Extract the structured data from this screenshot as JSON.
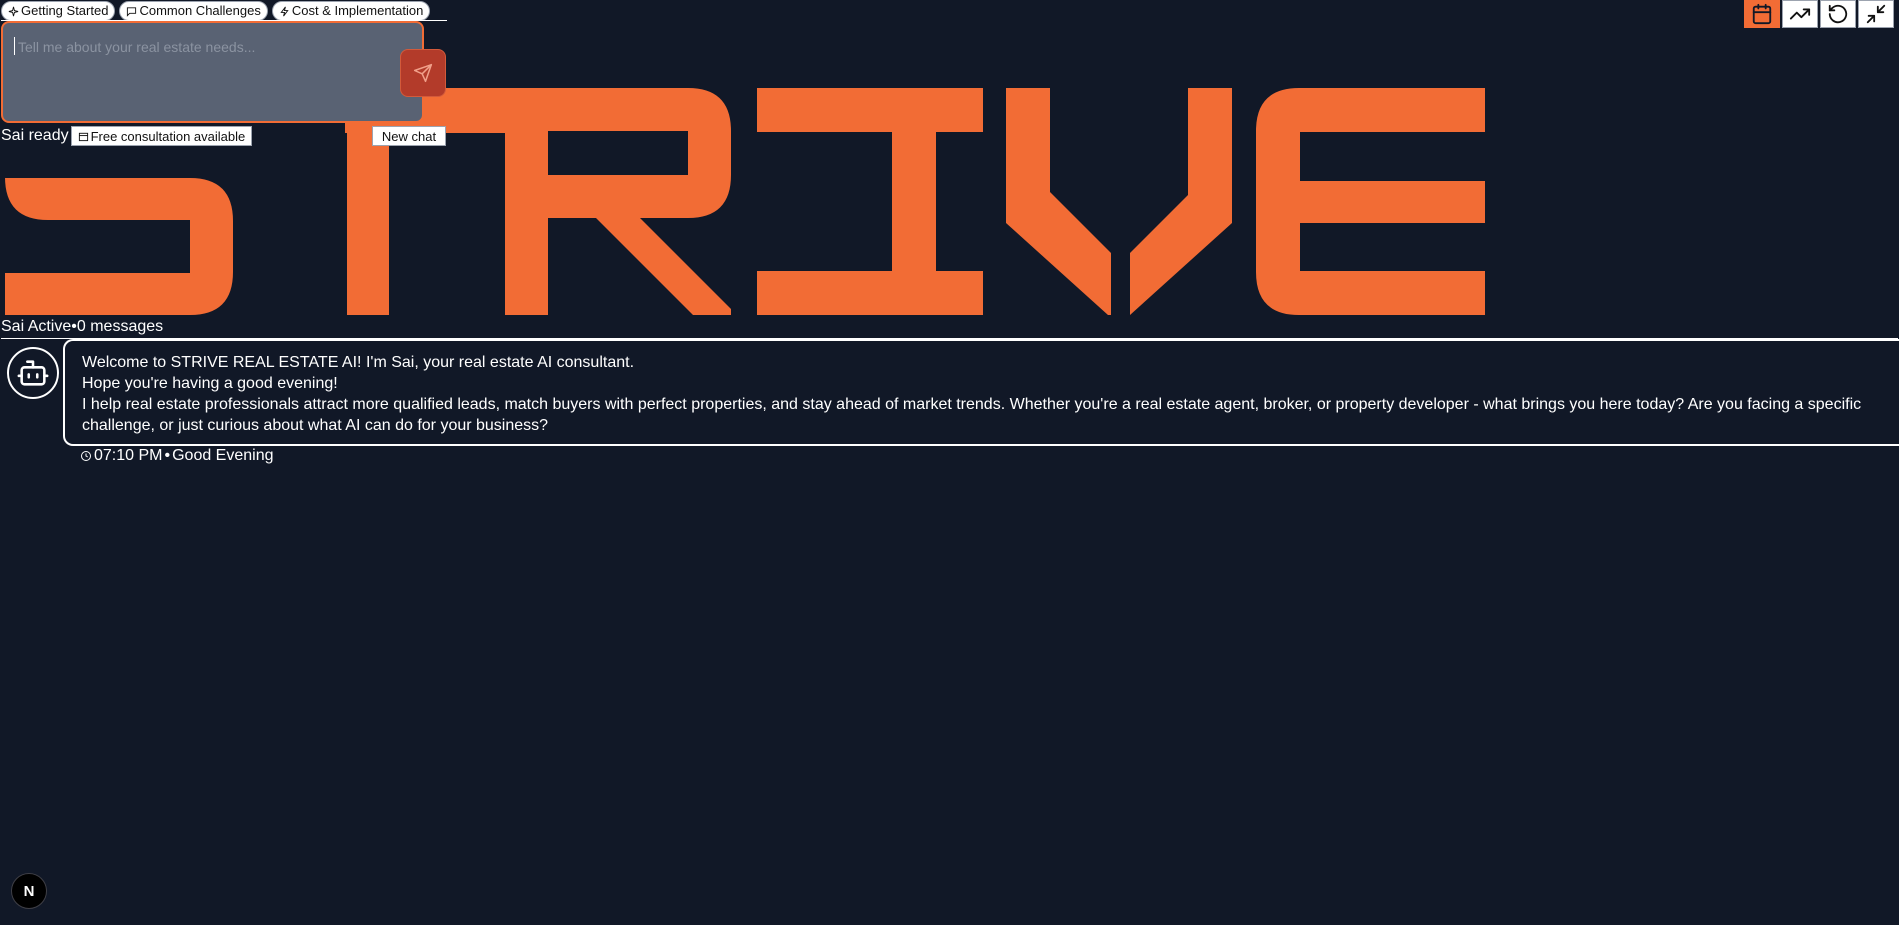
{
  "brand": {
    "logo_text": "STRIVE",
    "accent": "#f26c35",
    "background": "#111827"
  },
  "chips": [
    {
      "label": "Getting Started",
      "icon": "sparkle-icon"
    },
    {
      "label": "Common Challenges",
      "icon": "chat-bubble-icon"
    },
    {
      "label": "Cost & Implementation",
      "icon": "lightning-icon"
    }
  ],
  "composer": {
    "placeholder": "Tell me about your real estate needs...",
    "value": "",
    "send_icon": "send-icon"
  },
  "status": {
    "ready_text": "Sai ready",
    "consultation_label": "Free consultation available",
    "new_chat_label": "New chat"
  },
  "activity": {
    "name": "Sai Active",
    "separator": "•",
    "messages": "0 messages"
  },
  "message": {
    "avatar_icon": "robot-icon",
    "lines": [
      "Welcome to STRIVE REAL ESTATE AI! I'm Sai, your real estate AI consultant.",
      "Hope you're having a good evening!",
      "I help real estate professionals attract more qualified leads, match buyers with perfect properties, and stay ahead of market trends. Whether you're a real estate agent, broker, or property developer - what brings you here today? Are you facing a specific challenge, or just curious about what AI can do for your business?"
    ],
    "time": "07:10 PM",
    "separator": "•",
    "greeting": "Good Evening"
  },
  "toolbar": [
    "calendar-icon",
    "trending-up-icon",
    "refresh-icon",
    "minimize-icon"
  ],
  "dev_badge": "N"
}
